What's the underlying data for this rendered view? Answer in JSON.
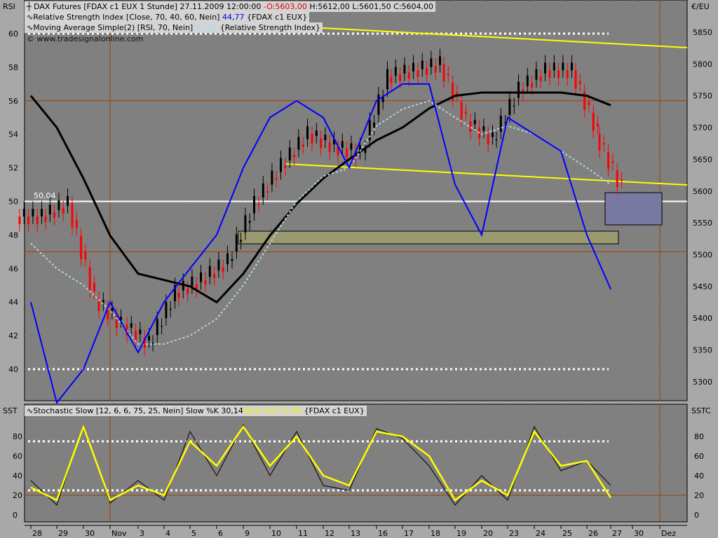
{
  "chart_data": [
    {
      "type": "candlestick",
      "panel": "RSI / price",
      "left_axis_label": "RSI",
      "right_axis_label": "€/EU",
      "header": {
        "instrument": "DAX Futures [FDAX c1 EUX  1 Stunde]",
        "datetime": "27.11.2009 12:00:00",
        "dash": "-",
        "open": "O:5603,00",
        "high": "H:5612,00",
        "low": "L:5601,50",
        "close": "C:5604,00"
      },
      "rsi_legend": {
        "name": "Relative Strength Index [Close, 70, 40, 60, Nein]",
        "value": "44,77",
        "source": "{FDAX c1 EUX}"
      },
      "ma_legend": {
        "name": "Moving Average Simple(2) [RSI, 70, Nein]",
        "value": "51,01",
        "source": "{Relative Strength Index}"
      },
      "watermark": "© www.tradesignalonline.com",
      "level_label": "50,04",
      "left_ticks": [
        "60",
        "58",
        "56",
        "54",
        "52",
        "50",
        "48",
        "46",
        "44",
        "42",
        "40"
      ],
      "right_ticks": [
        "5850",
        "5800",
        "5750",
        "5700",
        "5650",
        "5600",
        "5550",
        "5500",
        "5450",
        "5400",
        "5350",
        "5300"
      ],
      "ylim_rsi": [
        38,
        62
      ],
      "ylim_price": [
        5280,
        5870
      ],
      "x_labels": [
        "28",
        "29",
        "30",
        "Nov",
        "3",
        "4",
        "5",
        "6",
        "9",
        "10",
        "11",
        "12",
        "13",
        "16",
        "17",
        "18",
        "19",
        "20",
        "23",
        "24",
        "25",
        "26",
        "27",
        "30",
        "Dez"
      ],
      "price_close": [
        5560,
        5580,
        5430,
        5390,
        5360,
        5440,
        5460,
        5490,
        5580,
        5640,
        5690,
        5670,
        5660,
        5780,
        5790,
        5800,
        5710,
        5680,
        5760,
        5790,
        5790,
        5690,
        5604
      ],
      "price_ma": [
        5750,
        5700,
        5620,
        5530,
        5470,
        5460,
        5450,
        5425,
        5470,
        5530,
        5580,
        5620,
        5650,
        5680,
        5700,
        5730,
        5750,
        5755,
        5755,
        5755,
        5755,
        5750,
        5735
      ],
      "rsi": [
        44,
        38,
        40,
        44,
        41,
        44,
        46,
        48,
        52,
        55,
        56,
        55,
        52,
        56,
        57,
        57,
        51,
        48,
        55,
        54,
        53,
        48,
        44.77
      ],
      "rsi_ma": [
        47.5,
        46,
        45,
        43.5,
        41.5,
        41.5,
        42,
        43,
        45,
        47.5,
        50,
        51.5,
        52,
        54.5,
        55.5,
        56,
        55,
        54,
        54.5,
        54,
        53,
        52,
        51.01
      ],
      "colors": {
        "rsi": "#0000ff",
        "rsi_ma": "#add8e6",
        "price_ma": "#000000",
        "trend": "#ffff00",
        "up": "#000000",
        "down": "#ff0000"
      }
    },
    {
      "type": "line",
      "panel": "Stochastic",
      "left_axis_label": "SST",
      "right_axis_label": "SSTC",
      "legend": {
        "name": "Stochastic Slow [12, 6, 6, 75, 25, Nein] Slow %K",
        "k_value": "30,14",
        "d_label": "Slow %D",
        "d_value": "17,48",
        "source": "{FDAX c1 EUX}"
      },
      "ticks": [
        "80",
        "60",
        "40",
        "20",
        "0"
      ],
      "ylim": [
        -5,
        95
      ],
      "k": [
        35,
        10,
        92,
        12,
        35,
        15,
        85,
        40,
        92,
        40,
        85,
        30,
        25,
        88,
        78,
        50,
        10,
        40,
        15,
        90,
        45,
        55,
        30.14
      ],
      "d": [
        28,
        15,
        90,
        15,
        30,
        20,
        75,
        50,
        90,
        50,
        80,
        40,
        30,
        85,
        80,
        60,
        15,
        35,
        20,
        85,
        50,
        55,
        17.48
      ]
    }
  ]
}
